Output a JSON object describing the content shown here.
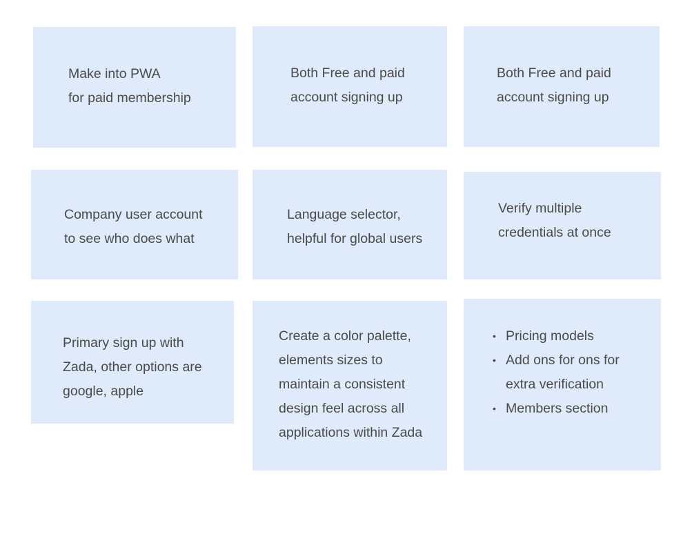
{
  "notes": [
    {
      "text": "Make into PWA\nfor paid membership"
    },
    {
      "text": "Both Free and paid\naccount signing up"
    },
    {
      "text": "Both Free and paid\naccount signing up"
    },
    {
      "text": "Company user account\nto see who does what"
    },
    {
      "text": "Language selector,\nhelpful for global users"
    },
    {
      "text": "Verify multiple\ncredentials at once"
    },
    {
      "text": "Primary sign up with\nZada, other options are\ngoogle, apple"
    },
    {
      "text": "Create a color palette,\nelements sizes to\nmaintain a consistent\ndesign feel across all\napplications within Zada"
    },
    {
      "bullet": "•",
      "items": [
        "Pricing models",
        "Add ons for ons for\nextra verification",
        "Members section"
      ]
    }
  ]
}
